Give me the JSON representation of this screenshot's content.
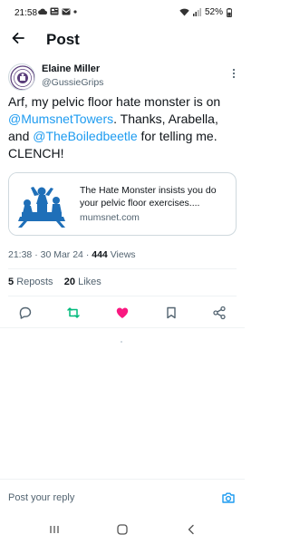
{
  "status_bar": {
    "time": "21:58",
    "battery": "52%",
    "icons": [
      "cloud-icon",
      "news-icon",
      "mail-icon",
      "dot-icon",
      "wifi-icon",
      "signal-icon",
      "battery-icon"
    ]
  },
  "header": {
    "back_icon": "arrow-left-icon",
    "title": "Post"
  },
  "post": {
    "author_name": "Elaine Miller",
    "author_handle": "@GussieGrips",
    "text_parts": {
      "p1": "Arf, my pelvic floor hate monster is on ",
      "m1": "@MumsnetTowers",
      "p2": ".  Thanks, Arabella, and ",
      "m2": "@TheBoiledbeetle",
      "p3": " for telling me. CLENCH!"
    },
    "card": {
      "title": "The Hate Monster insists you do your pelvic floor exercises....",
      "domain": "mumsnet.com"
    },
    "meta": {
      "time": "21:38",
      "sep": "·",
      "date": "30 Mar 24",
      "sep2": "·",
      "views_count": "444",
      "views_label": "Views"
    },
    "stats": {
      "reposts_count": "5",
      "reposts_label": "Reposts",
      "likes_count": "20",
      "likes_label": "Likes"
    },
    "liked": true
  },
  "colors": {
    "accent": "#1d9bf0",
    "repost": "#00ba7c",
    "like": "#f91880",
    "muted": "#536471"
  },
  "reply": {
    "placeholder": "Post your reply"
  },
  "nav_bar": {
    "icons": [
      "recents-icon",
      "home-icon",
      "back-icon"
    ]
  }
}
